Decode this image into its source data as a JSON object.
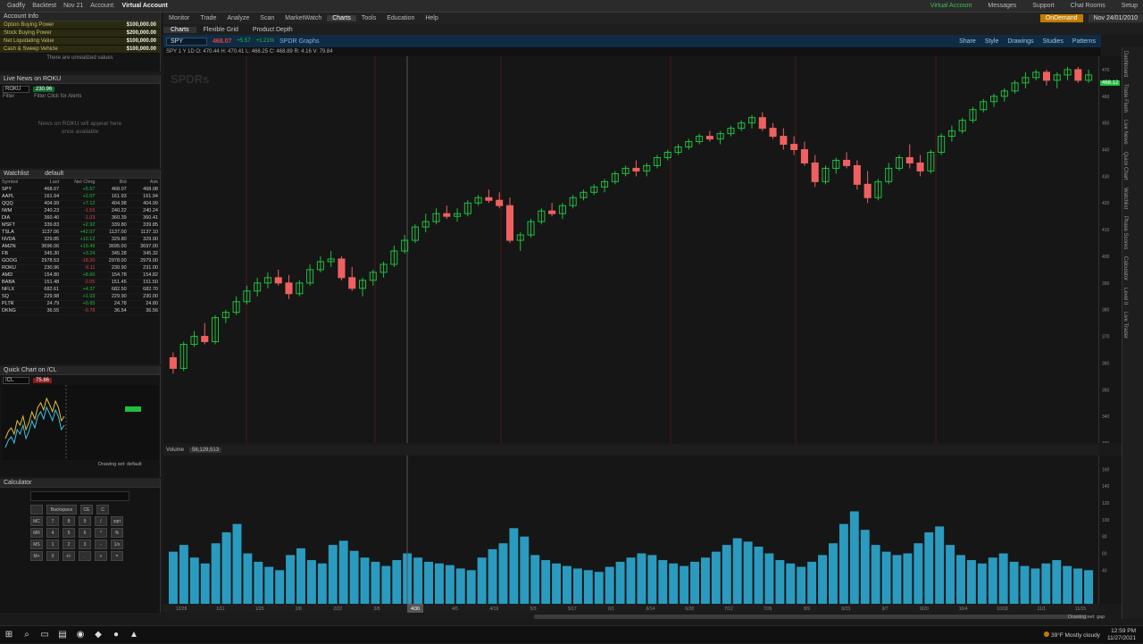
{
  "topbar": {
    "items": [
      "Gadfly",
      "Backtest",
      "Nov 21",
      "Account:",
      "Virtual Account"
    ],
    "right": [
      "Virtual Account",
      "Messages",
      "Support",
      "Chat Rooms",
      "Setup"
    ]
  },
  "menu": {
    "items": [
      "Monitor",
      "Trade",
      "Analyze",
      "Scan",
      "MarketWatch",
      "Charts",
      "Tools",
      "Education",
      "Help"
    ],
    "active": "Charts",
    "ondemand": "OnDemand",
    "date": "Nov 24/01/2010"
  },
  "chartsbar": {
    "items": [
      "Charts",
      "Flexible Grid",
      "Product Depth"
    ]
  },
  "symbolbar": {
    "symbol": "SPY",
    "price": "468.07",
    "change": "+5.57",
    "change_pct": "+1.21%",
    "label": "SPDR Graphs",
    "tools": [
      "Share",
      "Style",
      "Drawings",
      "Studies",
      "Patterns"
    ]
  },
  "ohlc": "SPY 1 Y 1D  O: 470.44  H: 470.41  L: 466.25  C: 468.89  R: 4.16  V: 79.84",
  "chart": {
    "watermark": "SPDRs",
    "price_label": "468.12",
    "price_ticks": [
      "470",
      "460",
      "450",
      "440",
      "430",
      "420",
      "410",
      "400",
      "390",
      "380",
      "370",
      "360",
      "350",
      "340",
      "330"
    ],
    "time_labels": [
      "12/28",
      "1/11",
      "1/25",
      "2/8",
      "2/22",
      "3/8",
      "3/22",
      "4/5",
      "4/19",
      "5/3",
      "5/17",
      "6/1",
      "6/14",
      "6/28",
      "7/12",
      "7/26",
      "8/9",
      "8/23",
      "9/7",
      "9/20",
      "10/4",
      "10/18",
      "11/1",
      "11/15"
    ],
    "time_highlight": "4/30"
  },
  "chart_data": {
    "type": "candlestick",
    "title": "SPY",
    "xlabel": "",
    "ylabel": "",
    "series": [
      {
        "name": "SPY",
        "values": [
          [
            362,
            364,
            356,
            358
          ],
          [
            358,
            368,
            357,
            367
          ],
          [
            367,
            372,
            366,
            370
          ],
          [
            370,
            375,
            367,
            368
          ],
          [
            368,
            378,
            367,
            377
          ],
          [
            377,
            380,
            375,
            379
          ],
          [
            379,
            385,
            378,
            383
          ],
          [
            383,
            389,
            382,
            387
          ],
          [
            387,
            392,
            385,
            390
          ],
          [
            390,
            394,
            388,
            392
          ],
          [
            392,
            395,
            389,
            390
          ],
          [
            390,
            393,
            384,
            386
          ],
          [
            386,
            391,
            385,
            390
          ],
          [
            390,
            397,
            389,
            395
          ],
          [
            395,
            400,
            394,
            398
          ],
          [
            398,
            402,
            396,
            399
          ],
          [
            399,
            400,
            391,
            392
          ],
          [
            392,
            396,
            387,
            388
          ],
          [
            388,
            392,
            385,
            391
          ],
          [
            391,
            395,
            389,
            394
          ],
          [
            394,
            398,
            392,
            397
          ],
          [
            397,
            404,
            396,
            402
          ],
          [
            402,
            408,
            401,
            406
          ],
          [
            406,
            412,
            405,
            411
          ],
          [
            411,
            416,
            409,
            413
          ],
          [
            413,
            418,
            412,
            416
          ],
          [
            416,
            419,
            414,
            415
          ],
          [
            415,
            418,
            413,
            416
          ],
          [
            416,
            421,
            415,
            420
          ],
          [
            420,
            423,
            419,
            422
          ],
          [
            422,
            425,
            420,
            421
          ],
          [
            421,
            424,
            418,
            419
          ],
          [
            419,
            422,
            405,
            406
          ],
          [
            406,
            409,
            402,
            408
          ],
          [
            408,
            414,
            407,
            413
          ],
          [
            413,
            418,
            412,
            417
          ],
          [
            417,
            420,
            415,
            416
          ],
          [
            416,
            420,
            414,
            419
          ],
          [
            419,
            423,
            418,
            422
          ],
          [
            422,
            425,
            421,
            424
          ],
          [
            424,
            427,
            423,
            426
          ],
          [
            426,
            429,
            424,
            428
          ],
          [
            428,
            432,
            427,
            431
          ],
          [
            431,
            434,
            430,
            433
          ],
          [
            433,
            436,
            430,
            432
          ],
          [
            432,
            435,
            430,
            434
          ],
          [
            434,
            438,
            433,
            437
          ],
          [
            437,
            440,
            436,
            439
          ],
          [
            439,
            442,
            438,
            441
          ],
          [
            441,
            444,
            440,
            443
          ],
          [
            443,
            446,
            442,
            445
          ],
          [
            445,
            447,
            443,
            444
          ],
          [
            444,
            447,
            442,
            446
          ],
          [
            446,
            449,
            445,
            448
          ],
          [
            448,
            451,
            447,
            450
          ],
          [
            450,
            453,
            448,
            452
          ],
          [
            452,
            454,
            447,
            448
          ],
          [
            448,
            450,
            444,
            445
          ],
          [
            445,
            448,
            440,
            442
          ],
          [
            442,
            445,
            438,
            440
          ],
          [
            440,
            443,
            434,
            435
          ],
          [
            435,
            438,
            426,
            428
          ],
          [
            428,
            434,
            427,
            433
          ],
          [
            433,
            437,
            431,
            436
          ],
          [
            436,
            439,
            433,
            434
          ],
          [
            434,
            436,
            425,
            427
          ],
          [
            427,
            432,
            420,
            422
          ],
          [
            422,
            429,
            421,
            428
          ],
          [
            428,
            435,
            427,
            433
          ],
          [
            433,
            438,
            432,
            437
          ],
          [
            437,
            442,
            433,
            435
          ],
          [
            435,
            438,
            430,
            432
          ],
          [
            432,
            440,
            431,
            439
          ],
          [
            439,
            446,
            438,
            445
          ],
          [
            445,
            449,
            443,
            447
          ],
          [
            447,
            452,
            446,
            451
          ],
          [
            451,
            456,
            450,
            455
          ],
          [
            455,
            459,
            454,
            458
          ],
          [
            458,
            461,
            456,
            460
          ],
          [
            460,
            463,
            458,
            462
          ],
          [
            462,
            466,
            461,
            465
          ],
          [
            465,
            469,
            463,
            467
          ],
          [
            467,
            470,
            466,
            469
          ],
          [
            469,
            470,
            464,
            466
          ],
          [
            466,
            469,
            463,
            468
          ],
          [
            468,
            471,
            466,
            470
          ],
          [
            470,
            471,
            465,
            466
          ],
          [
            466,
            470,
            465,
            468
          ]
        ]
      }
    ]
  },
  "volume": {
    "header": "Volume",
    "value": "58,129,513",
    "ticks": [
      "160",
      "140",
      "120",
      "100",
      "80",
      "60",
      "40"
    ],
    "values": [
      62,
      70,
      55,
      48,
      72,
      85,
      95,
      60,
      50,
      44,
      40,
      58,
      66,
      52,
      48,
      70,
      75,
      63,
      55,
      50,
      45,
      52,
      60,
      55,
      50,
      48,
      46,
      42,
      40,
      55,
      65,
      72,
      90,
      80,
      58,
      52,
      48,
      45,
      42,
      40,
      38,
      44,
      50,
      55,
      60,
      58,
      52,
      48,
      45,
      50,
      55,
      62,
      70,
      78,
      74,
      68,
      60,
      52,
      48,
      44,
      50,
      58,
      72,
      95,
      110,
      88,
      70,
      62,
      58,
      60,
      72,
      85,
      92,
      70,
      58,
      52,
      48,
      55,
      60,
      50,
      45,
      42,
      48,
      52,
      45,
      42,
      40
    ]
  },
  "left": {
    "account": {
      "title": "Account Info",
      "rows": [
        {
          "label": "Option Buying Power",
          "value": "$100,000.00"
        },
        {
          "label": "Stock Buying Power",
          "value": "$200,000.00"
        },
        {
          "label": "Net Liquidating Value",
          "value": "$100,000.00"
        },
        {
          "label": "Cash & Sweep Vehicle",
          "value": "$100,000.00"
        }
      ],
      "note": "There are unrealized values"
    },
    "news": {
      "title": "Live News on ROKU",
      "symbol": "ROKU",
      "price": "230.96",
      "filter_label": "Filter",
      "filter_placeholder": "Filter Click for Alerts",
      "message": "News on ROKU will appear here once available"
    },
    "watchlist": {
      "title": "Watchlist",
      "name": "default",
      "headers": [
        "Symbol",
        "Last",
        "Net Chng",
        "Bid",
        "Ask"
      ],
      "rows": [
        [
          "SPY",
          "468.07",
          "+5.57",
          "468.07",
          "468.08"
        ],
        [
          "AAPL",
          "161.94",
          "+2.07",
          "161.93",
          "161.94"
        ],
        [
          "QQQ",
          "404.99",
          "+7.12",
          "404.98",
          "404.99"
        ],
        [
          "IWM",
          "240.23",
          "-1.56",
          "240.22",
          "240.24"
        ],
        [
          "DIA",
          "360.40",
          "-1.03",
          "360.39",
          "360.41"
        ],
        [
          "MSFT",
          "339.83",
          "+2.92",
          "339.80",
          "339.85"
        ],
        [
          "TSLA",
          "1137.06",
          "+42.07",
          "1137.00",
          "1137.10"
        ],
        [
          "NVDA",
          "329.85",
          "+10.12",
          "329.80",
          "329.90"
        ],
        [
          "AMZN",
          "3696.06",
          "+19.49",
          "3695.00",
          "3697.00"
        ],
        [
          "FB",
          "345.30",
          "+3.24",
          "345.28",
          "345.32"
        ],
        [
          "GOOG",
          "2978.53",
          "-18.20",
          "2978.00",
          "2979.00"
        ],
        [
          "ROKU",
          "230.96",
          "-9.11",
          "230.90",
          "231.00"
        ],
        [
          "AMD",
          "154.80",
          "+8.60",
          "154.78",
          "154.82"
        ],
        [
          "BABA",
          "151.48",
          "-2.05",
          "151.45",
          "151.50"
        ],
        [
          "NFLX",
          "682.61",
          "+4.37",
          "682.50",
          "682.70"
        ],
        [
          "SQ",
          "229.98",
          "+1.03",
          "229.90",
          "230.00"
        ],
        [
          "PLTR",
          "24.79",
          "+0.65",
          "24.78",
          "24.80"
        ],
        [
          "DKNG",
          "36.55",
          "-0.78",
          "36.54",
          "36.56"
        ]
      ]
    },
    "quickchart": {
      "title": "Quick Chart on /CL",
      "symbol": "/CL",
      "price": "75.86",
      "drawing_label": "Drawing set: default"
    },
    "calculator": {
      "title": "Calculator",
      "keys_row1": [
        "Backspace",
        "CE",
        "C"
      ],
      "keys": [
        [
          "MC",
          "7",
          "8",
          "9",
          "/",
          "sqrt"
        ],
        [
          "MR",
          "4",
          "5",
          "6",
          "*",
          "%"
        ],
        [
          "MS",
          "1",
          "2",
          "3",
          "-",
          "1/x"
        ],
        [
          "M+",
          "0",
          "+/-",
          ".",
          "+",
          "="
        ]
      ]
    }
  },
  "righttabs": [
    "Dashboard",
    "Trade Flash",
    "Live News",
    "Quick Chart",
    "Watchlist",
    "Phase Scores",
    "Calculator",
    "Level II",
    "Live Trader"
  ],
  "statusbar": "Drawing set: gap",
  "taskbar": {
    "weather": "39°F Mostly cloudy",
    "time": "12:59 PM",
    "date": "11/27/2021"
  }
}
